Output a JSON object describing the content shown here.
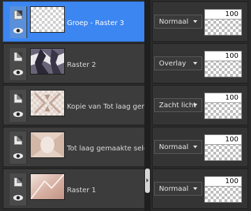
{
  "layers": [
    {
      "name": "Groep - Raster 3",
      "selected": true,
      "thumb": "transparent",
      "blend": "Normaal",
      "opacity": "100"
    },
    {
      "name": "Raster 2",
      "selected": false,
      "thumb": "dark-abstract",
      "blend": "Overlay",
      "opacity": "100"
    },
    {
      "name": "Kopie van Tot laag gemaakte selectie",
      "selected": false,
      "thumb": "beige-pattern",
      "blend": "Zacht licht",
      "opacity": "100"
    },
    {
      "name": "Tot laag gemaakte selectie",
      "selected": false,
      "thumb": "beige-pattern",
      "blend": "Normaal",
      "opacity": "100"
    },
    {
      "name": "Raster 1",
      "selected": false,
      "thumb": "pink-gradient",
      "blend": "Normaal",
      "opacity": "100"
    }
  ],
  "icons": {
    "doc": "layer-doc-icon",
    "eye": "visibility-eye-icon"
  },
  "colors": {
    "selected": "#3c86f1",
    "row": "#3c3c3c",
    "background": "#2b2b2b"
  }
}
